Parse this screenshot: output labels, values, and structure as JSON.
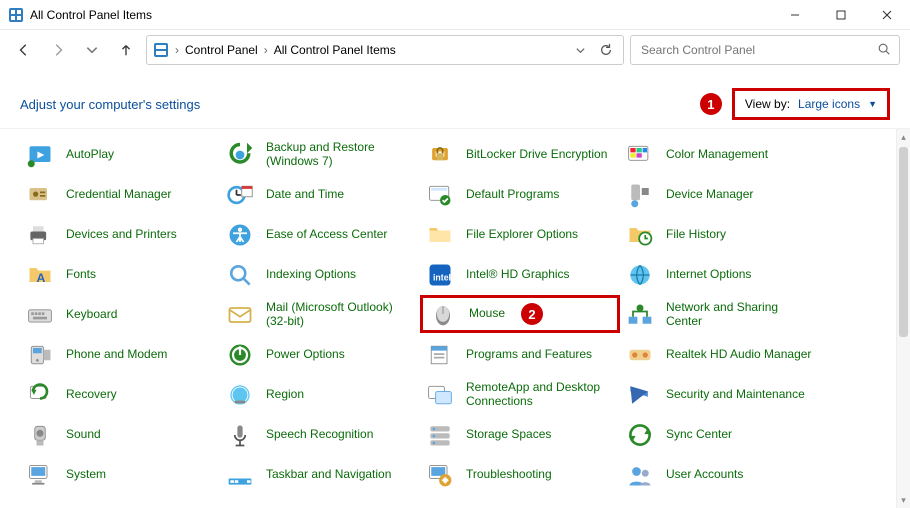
{
  "window": {
    "title": "All Control Panel Items"
  },
  "breadcrumb": {
    "seg1": "Control Panel",
    "sep": "›",
    "seg2": "All Control Panel Items"
  },
  "search": {
    "placeholder": "Search Control Panel"
  },
  "heading": "Adjust your computer's settings",
  "viewby": {
    "label": "View by:",
    "value": "Large icons"
  },
  "annotations": {
    "one": "1",
    "two": "2"
  },
  "items": [
    {
      "label": "AutoPlay"
    },
    {
      "label": "Backup and Restore (Windows 7)"
    },
    {
      "label": "BitLocker Drive Encryption"
    },
    {
      "label": "Color Management"
    },
    {
      "label": "Credential Manager"
    },
    {
      "label": "Date and Time"
    },
    {
      "label": "Default Programs"
    },
    {
      "label": "Device Manager"
    },
    {
      "label": "Devices and Printers"
    },
    {
      "label": "Ease of Access Center"
    },
    {
      "label": "File Explorer Options"
    },
    {
      "label": "File History"
    },
    {
      "label": "Fonts"
    },
    {
      "label": "Indexing Options"
    },
    {
      "label": "Intel® HD Graphics"
    },
    {
      "label": "Internet Options"
    },
    {
      "label": "Keyboard"
    },
    {
      "label": "Mail (Microsoft Outlook) (32-bit)"
    },
    {
      "label": "Mouse",
      "highlight": true
    },
    {
      "label": "Network and Sharing Center"
    },
    {
      "label": "Phone and Modem"
    },
    {
      "label": "Power Options"
    },
    {
      "label": "Programs and Features"
    },
    {
      "label": "Realtek HD Audio Manager"
    },
    {
      "label": "Recovery"
    },
    {
      "label": "Region"
    },
    {
      "label": "RemoteApp and Desktop Connections"
    },
    {
      "label": "Security and Maintenance"
    },
    {
      "label": "Sound"
    },
    {
      "label": "Speech Recognition"
    },
    {
      "label": "Storage Spaces"
    },
    {
      "label": "Sync Center"
    },
    {
      "label": "System"
    },
    {
      "label": "Taskbar and Navigation"
    },
    {
      "label": "Troubleshooting"
    },
    {
      "label": "User Accounts"
    }
  ]
}
